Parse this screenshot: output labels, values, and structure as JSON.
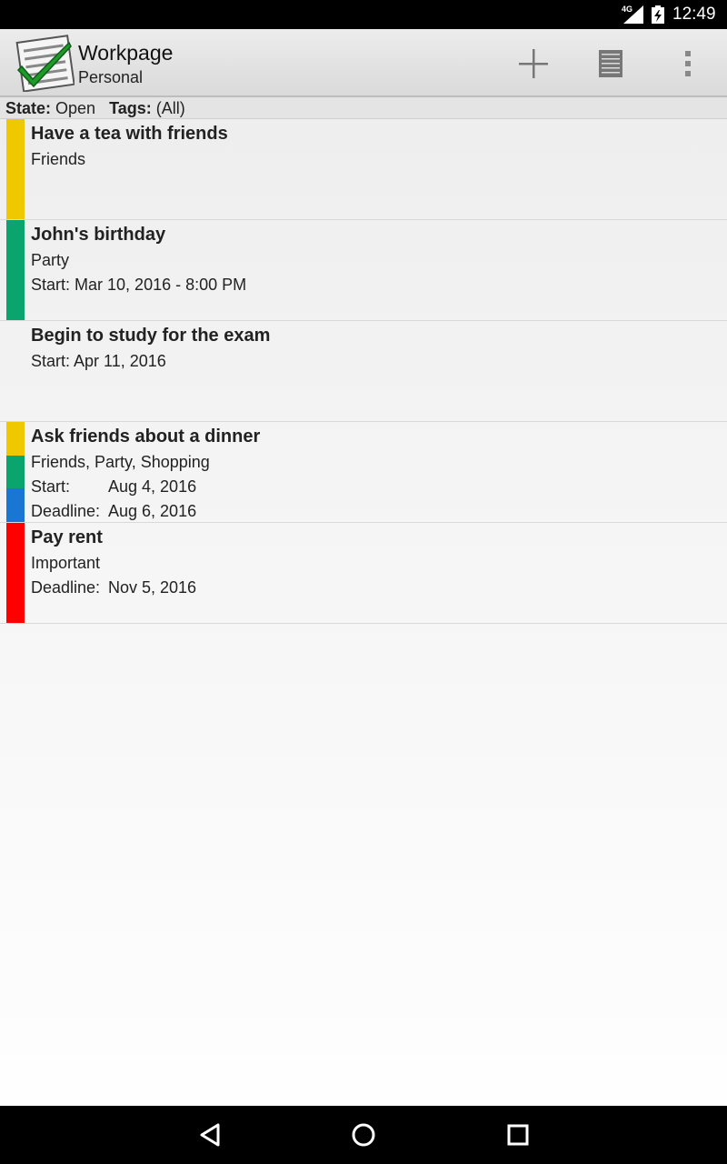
{
  "status_bar": {
    "network": "4G",
    "time": "12:49"
  },
  "action_bar": {
    "title": "Workpage",
    "subtitle": "Personal",
    "icons": [
      "checklist-app-icon",
      "add-icon",
      "list-icon",
      "overflow-menu-icon"
    ]
  },
  "filter": {
    "state_label": "State:",
    "state_value": "Open",
    "tags_label": "Tags:",
    "tags_value": "(All)"
  },
  "tasks": [
    {
      "title": "Have a tea with friends",
      "tags": "Friends",
      "colors": [
        "#f0c800"
      ]
    },
    {
      "title": "John's birthday",
      "tags": "Party",
      "start_label": "Start:",
      "start_value": "Mar 10, 2016 - 8:00 PM",
      "colors": [
        "#0aa46f"
      ]
    },
    {
      "title": "Begin to study for the exam",
      "start_label": "Start:",
      "start_value": "Apr 11, 2016",
      "colors": []
    },
    {
      "title": "Ask friends about a dinner",
      "tags": "Friends, Party, Shopping",
      "start_label": "Start:",
      "start_value": "Aug 4, 2016",
      "deadline_label": "Deadline:",
      "deadline_value": "Aug 6, 2016",
      "colors": [
        "#f0c800",
        "#0aa46f",
        "#1976d2"
      ]
    },
    {
      "title": "Pay rent",
      "tags": "Important",
      "deadline_label": "Deadline:",
      "deadline_value": "Nov 5, 2016",
      "colors": [
        "#ff0000"
      ]
    }
  ],
  "nav_bar": {
    "icons": [
      "back-icon",
      "home-icon",
      "recents-icon"
    ]
  }
}
